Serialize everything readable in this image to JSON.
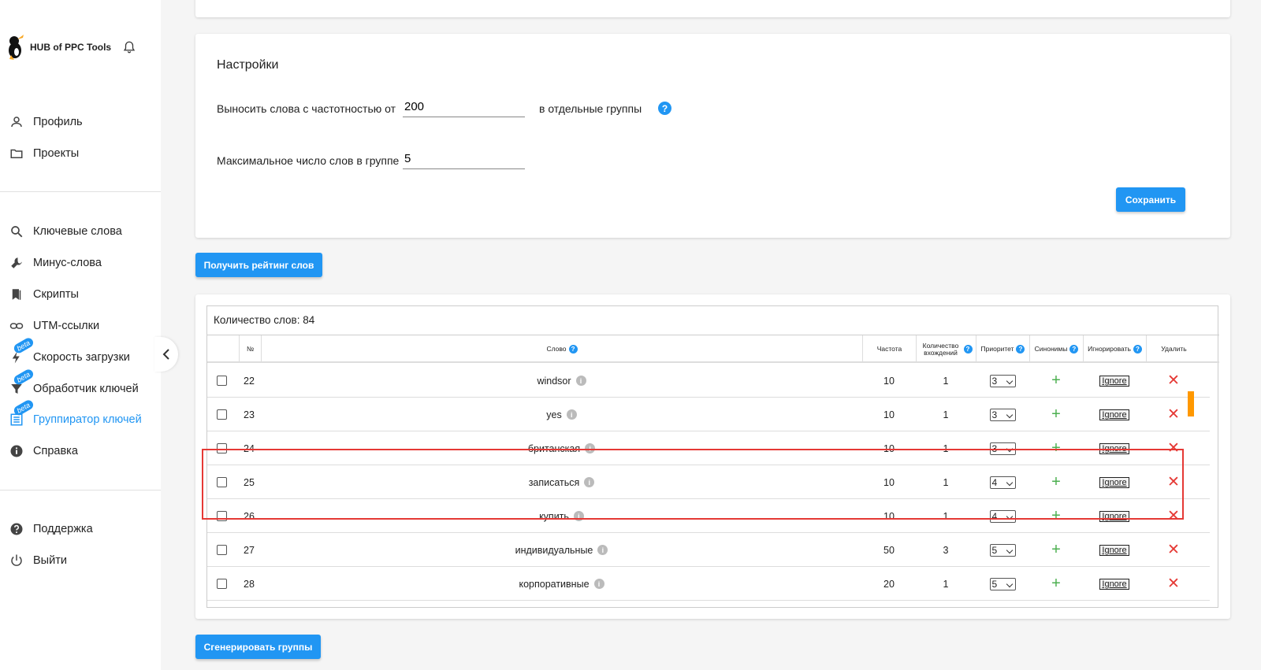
{
  "brand": {
    "name": "HUB of PPC Tools"
  },
  "sidebar": {
    "group1": [
      {
        "label": "Профиль",
        "icon": "person-icon"
      },
      {
        "label": "Проекты",
        "icon": "folder-icon"
      }
    ],
    "group2": [
      {
        "label": "Ключевые слова",
        "icon": "search-icon"
      },
      {
        "label": "Минус-слова",
        "icon": "wrench-icon"
      },
      {
        "label": "Скрипты",
        "icon": "bookmark-icon"
      },
      {
        "label": "UTM-ссылки",
        "icon": "link-icon"
      },
      {
        "label": "Скорость загрузки",
        "icon": "bolt-icon",
        "badge": "beta"
      },
      {
        "label": "Обработчик ключей",
        "icon": "filter-icon",
        "badge": "beta"
      },
      {
        "label": "Группиратор ключей",
        "icon": "list-icon",
        "badge": "beta",
        "active": true
      },
      {
        "label": "Справка",
        "icon": "info-icon"
      }
    ],
    "group3": [
      {
        "label": "Поддержка",
        "icon": "help-icon"
      },
      {
        "label": "Выйти",
        "icon": "power-icon"
      }
    ]
  },
  "settings": {
    "title": "Настройки",
    "freq_label": "Выносить слова с частотностью от",
    "freq_value": "200",
    "freq_suffix": "в отдельные группы",
    "max_label": "Максимальное число слов в группе",
    "max_value": "5",
    "save_label": "Сохранить"
  },
  "rating_button": "Получить рейтинг слов",
  "generate_button": "Сгенерировать группы",
  "table": {
    "count_label": "Количество слов: 84",
    "headers": {
      "num": "№",
      "word": "Слово",
      "freq": "Частота",
      "occurrences": "Количество вхождений",
      "priority": "Приоритет",
      "synonyms": "Синонимы",
      "ignore": "Игнорировать",
      "delete": "Удалить"
    },
    "ignore_label": "Ignore",
    "rows": [
      {
        "num": "22",
        "word": "windsor",
        "freq": "10",
        "occ": "1",
        "priority": "3"
      },
      {
        "num": "23",
        "word": "yes",
        "freq": "10",
        "occ": "1",
        "priority": "3"
      },
      {
        "num": "24",
        "word": "британская",
        "freq": "10",
        "occ": "1",
        "priority": "3"
      },
      {
        "num": "25",
        "word": "записаться",
        "freq": "10",
        "occ": "1",
        "priority": "4"
      },
      {
        "num": "26",
        "word": "купить",
        "freq": "10",
        "occ": "1",
        "priority": "4"
      },
      {
        "num": "27",
        "word": "индивидуальные",
        "freq": "50",
        "occ": "3",
        "priority": "5"
      },
      {
        "num": "28",
        "word": "корпоративные",
        "freq": "20",
        "occ": "1",
        "priority": "5"
      }
    ]
  },
  "colors": {
    "accent": "#2196f3",
    "highlight": "#e53935",
    "add": "#4caf50",
    "scroll": "#ff9800"
  }
}
